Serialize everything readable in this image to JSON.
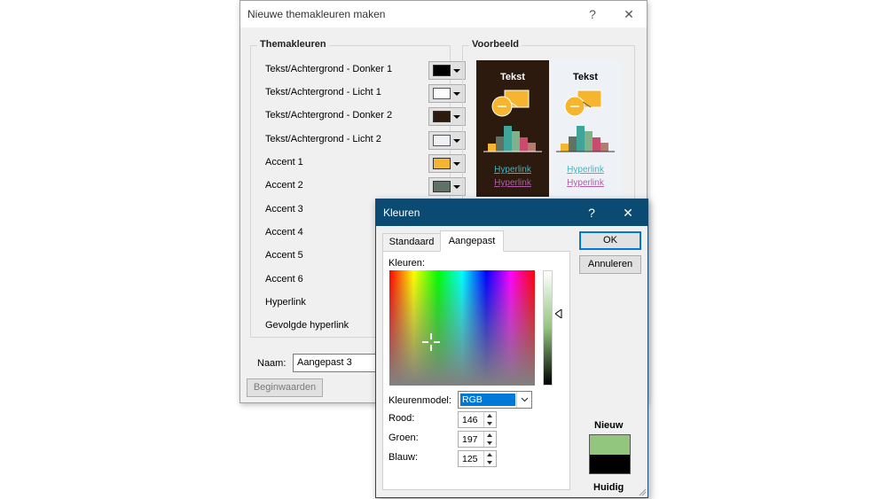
{
  "theme_dialog": {
    "title": "Nieuwe themakleuren maken",
    "help": "?",
    "close": "✕",
    "group_theme_colors": "Themakleuren",
    "group_preview": "Voorbeeld",
    "rows": [
      {
        "label": "Tekst/Achtergrond - Donker 1",
        "color": "#000000"
      },
      {
        "label": "Tekst/Achtergrond - Licht 1",
        "color": "#ffffff"
      },
      {
        "label": "Tekst/Achtergrond - Donker 2",
        "color": "#2b1a0d"
      },
      {
        "label": "Tekst/Achtergrond - Licht 2",
        "color": "#eef2f7"
      },
      {
        "label": "Accent 1",
        "color": "#f5b52f"
      },
      {
        "label": "Accent 2",
        "color": "#5e7266"
      },
      {
        "label": "Accent 3"
      },
      {
        "label": "Accent 4"
      },
      {
        "label": "Accent 5"
      },
      {
        "label": "Accent 6"
      },
      {
        "label": "Hyperlink"
      },
      {
        "label": "Gevolgde hyperlink"
      }
    ],
    "name_label": "Naam:",
    "name_value": "Aangepast 3",
    "reset_button": "Beginwaarden",
    "preview": {
      "dark_title": "Tekst",
      "light_title": "Tekst",
      "hyperlink": "Hyperlink",
      "followed_hyperlink": "Hyperlink",
      "dark_bg": "#2b1a0d",
      "light_bg": "#eef2f7",
      "hyperlink_color": "#3fb7c3",
      "followed_color": "#b05fa6",
      "bar_colors": [
        "#f5b52f",
        "#5e7266",
        "#3fa59a",
        "#7fb28a",
        "#c74c6e",
        "#b57b6c"
      ]
    }
  },
  "color_dialog": {
    "title": "Kleuren",
    "help": "?",
    "close": "✕",
    "tabs": [
      "Standaard",
      "Aangepast"
    ],
    "active_tab": "Aangepast",
    "colors_label": "Kleuren:",
    "model_label": "Kleurenmodel:",
    "model_value": "RGB",
    "red_label": "Rood:",
    "red_value": "146",
    "green_label": "Groen:",
    "green_value": "197",
    "blue_label": "Blauw:",
    "blue_value": "125",
    "ok_button": "OK",
    "cancel_button": "Annuleren",
    "new_label": "Nieuw",
    "current_label": "Huidig",
    "new_color": "#92c57d",
    "current_color": "#000000"
  }
}
